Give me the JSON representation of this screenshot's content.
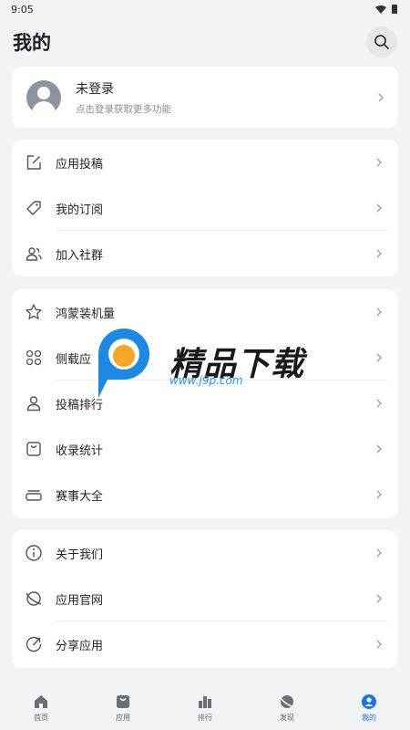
{
  "status": {
    "time": "9:05"
  },
  "header": {
    "title": "我的"
  },
  "profile": {
    "name": "未登录",
    "subtitle": "点击登录获取更多功能"
  },
  "group1": [
    {
      "label": "应用投稿",
      "icon": "edit-icon"
    },
    {
      "label": "我的订阅",
      "icon": "tag-icon"
    },
    {
      "label": "加入社群",
      "icon": "users-icon"
    }
  ],
  "group2": [
    {
      "label": "鸿蒙装机量",
      "icon": "star-icon"
    },
    {
      "label": "侧载应",
      "icon": "grid-icon"
    },
    {
      "label": "投稿排行",
      "icon": "user-icon"
    },
    {
      "label": "收录统计",
      "icon": "bag-icon"
    },
    {
      "label": "赛事大全",
      "icon": "stack-icon"
    }
  ],
  "group3": [
    {
      "label": "关于我们",
      "icon": "info-icon"
    },
    {
      "label": "应用官网",
      "icon": "planet-icon"
    },
    {
      "label": "分享应用",
      "icon": "share-icon"
    }
  ],
  "watermark": {
    "title": "精品下载",
    "url": "www.j9p.com"
  },
  "nav": [
    {
      "label": "首页",
      "icon": "home-icon"
    },
    {
      "label": "应用",
      "icon": "app-bag-icon"
    },
    {
      "label": "排行",
      "icon": "bar-chart-icon"
    },
    {
      "label": "发现",
      "icon": "discover-icon"
    },
    {
      "label": "我的",
      "icon": "profile-icon"
    }
  ],
  "colors": {
    "accent": "#1a73e8",
    "background": "#f1f3f5",
    "card": "#ffffff"
  }
}
